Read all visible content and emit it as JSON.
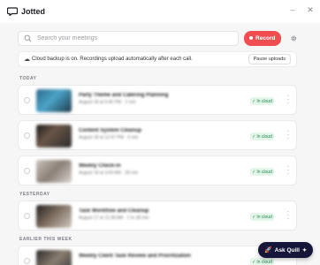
{
  "app": {
    "name": "Jotted",
    "window_controls": [
      "–",
      "✕"
    ]
  },
  "search": {
    "placeholder": "Search your meetings"
  },
  "record_button": {
    "label": "Record"
  },
  "banner": {
    "text": "Cloud backup is on. Recordings upload automatically after each call.",
    "pause_label": "Pause uploads"
  },
  "sections": {
    "today": "TODAY",
    "yesterday": "YESTERDAY",
    "earlier": "EARLIER THIS WEEK"
  },
  "meetings": [
    {
      "title": "Party Theme and Catering Planning",
      "sub": "August 18 at 6:40 PM · 2 min",
      "status": "In cloud"
    },
    {
      "title": "Content System Cleanup",
      "sub": "August 18 at 12:47 PM · 6 min",
      "status": "In cloud"
    },
    {
      "title": "Weekly Check-in",
      "sub": "August 18 at 3:00 AM · 28 min",
      "status": "In cloud"
    },
    {
      "title": "Task Workflow and Cleanup",
      "sub": "August 17 at 11:38 AM · 1 hr 38 min",
      "status": "In cloud"
    },
    {
      "title": "Weekly Client Task Review and Prioritization",
      "sub": "",
      "status": "In cloud"
    }
  ],
  "ask_button": {
    "label": "Ask Quill"
  },
  "colors": {
    "record": "#ef4d50",
    "badge_bg": "#e4f5e9",
    "badge_text": "#1f8b4c",
    "ask_bg": "#16163a"
  }
}
